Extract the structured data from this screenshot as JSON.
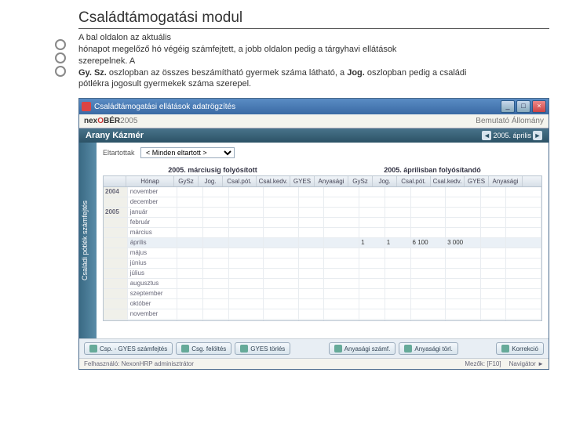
{
  "title": "Családtámogatási modul",
  "intro": {
    "l1": "A bal oldalon az aktuális",
    "l2": "hónapot megelőző hó végéig számfejtett, a jobb oldalon pedig a tárgyhavi ellátások",
    "l3": "szerepelnek. A",
    "l4a": "Gy. Sz.",
    "l4b": " oszlopban az összes beszámítható gyermek száma látható, a ",
    "l4c": "Jog.",
    "l4d": " oszlopban pedig a családi",
    "l5": "pótlékra jogosult gyermekek száma szerepel."
  },
  "win": {
    "title": "Családtámogatási ellátások adatrögzítés",
    "brand_a": "nex",
    "brand_b": "O",
    "brand_c": "BÉR",
    "brand_yr": " 2005",
    "tenant": "Bemutató Állomány"
  },
  "name": "Arany Kázmér",
  "period": {
    "prev": "◄",
    "val": "2005. április",
    "next": "►"
  },
  "sidetab": "Családi pótlék számfejtés",
  "filter": {
    "label": "Eltartottak",
    "value": "< Minden eltartott >"
  },
  "sections": {
    "left": "2005. márciusig folyósított",
    "right": "2005. áprilisban folyósítandó"
  },
  "cols": {
    "honap": "Hónap",
    "gysz": "GySz",
    "jog": "Jog.",
    "cspot": "Csal.pót.",
    "cskedv": "Csal.kedv.",
    "gyes": "GYES",
    "any": "Anyasági"
  },
  "years": {
    "y1": "2004",
    "y2": "2005"
  },
  "months": {
    "nov": "november",
    "dec": "december",
    "jan": "január",
    "feb": "február",
    "mar": "március",
    "apr": "április",
    "maj": "május",
    "jun": "június",
    "jul": "július",
    "aug": "augusztus",
    "sep": "szeptember",
    "okt": "október"
  },
  "data": {
    "apr": {
      "gysz": "1",
      "jog": "1",
      "cspot": "6 100",
      "cskedv": "3 000"
    }
  },
  "btns": {
    "b1": "Csp. - GYES számfejtés",
    "b2": "Csg. felöltés",
    "b3": "GYES törlés",
    "b4": "Anyasági számf.",
    "b5": "Anyasági törl.",
    "b6": "Korrekció"
  },
  "status": {
    "user": "Felhasználó: NexonHRP adminisztrátor",
    "help": "Mezők: [F10]",
    "nav": "Navigátor",
    "navicon": "►"
  }
}
